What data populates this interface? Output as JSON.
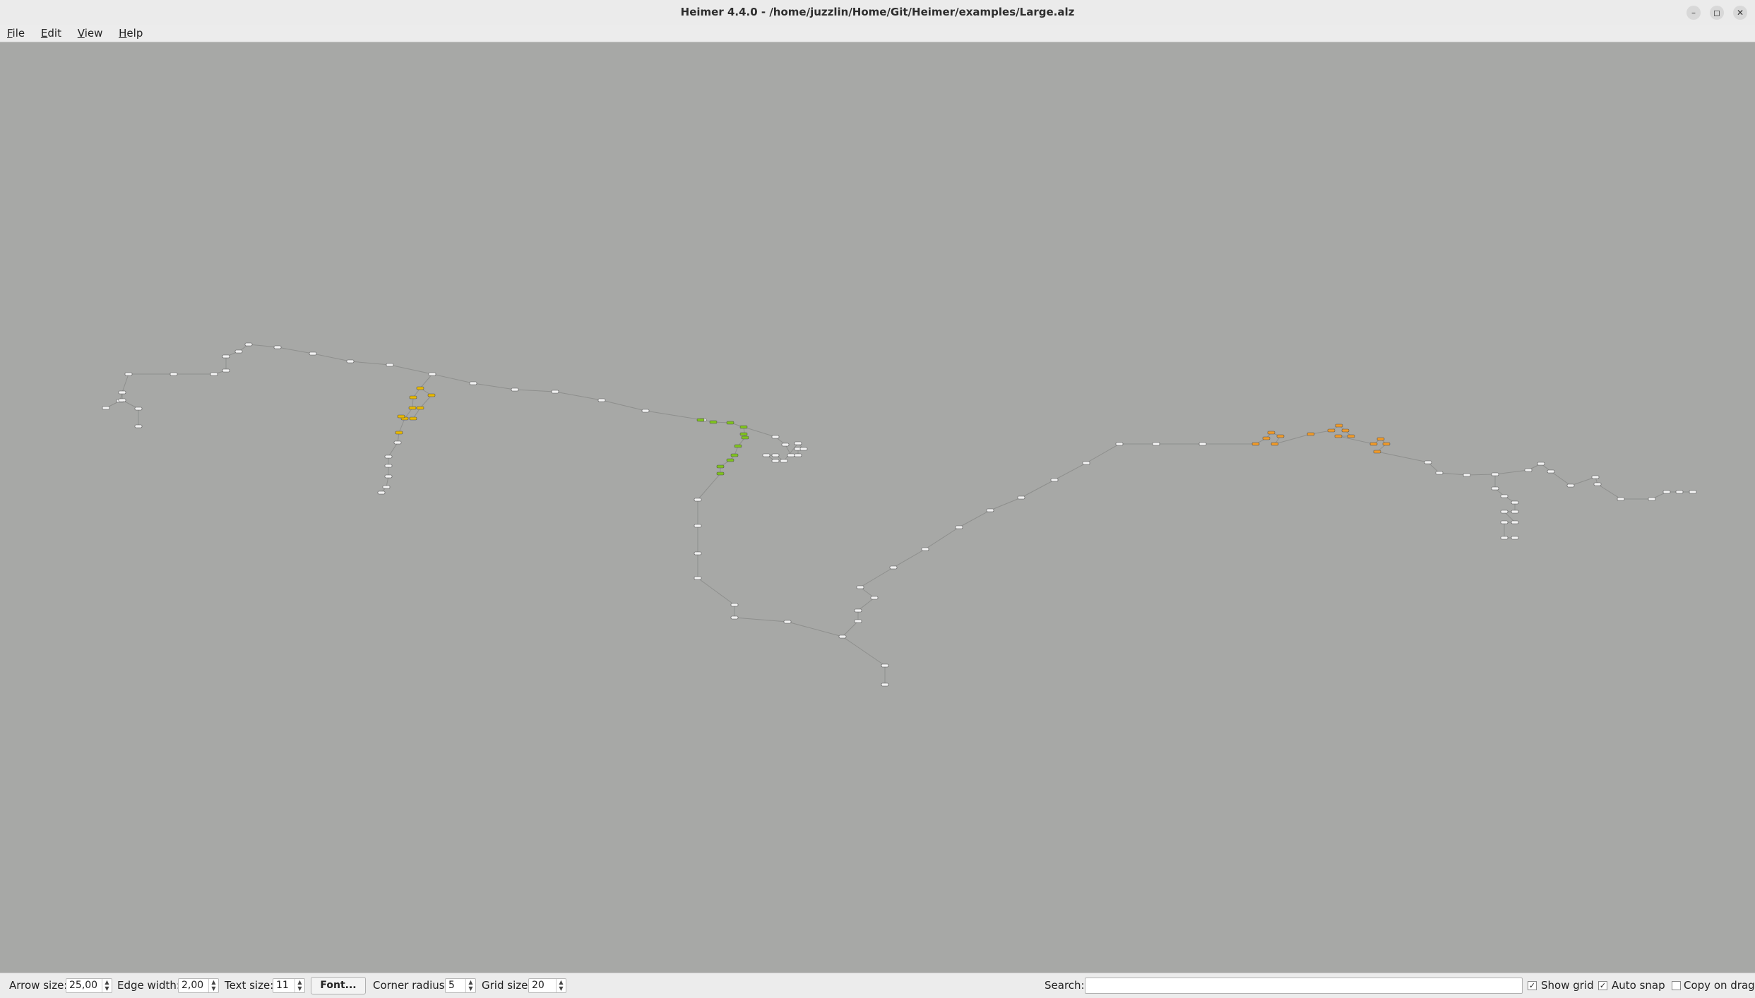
{
  "window": {
    "title": "Heimer 4.4.0 - /home/juzzlin/Home/Git/Heimer/examples/Large.alz",
    "minimize_glyph": "–",
    "maximize_glyph": "◻",
    "close_glyph": "✕"
  },
  "menubar": {
    "items": [
      {
        "mnemonic": "F",
        "rest": "ile"
      },
      {
        "mnemonic": "E",
        "rest": "dit"
      },
      {
        "mnemonic": "V",
        "rest": "iew"
      },
      {
        "mnemonic": "H",
        "rest": "elp"
      }
    ]
  },
  "canvas": {
    "background": "#a7a8a6",
    "edge_color": "#8e8f8d",
    "node_colors": {
      "white": "#f2f2f2",
      "yellow": "#e8b800",
      "green": "#7fc31d",
      "orange": "#f09a28"
    }
  },
  "statusbar": {
    "arrow_size_label": "Arrow size:",
    "arrow_size_value": "25,00",
    "edge_width_label": "Edge width:",
    "edge_width_value": "2,00",
    "text_size_label": "Text size:",
    "text_size_value": "11",
    "font_button": "Font...",
    "corner_radius_label": "Corner radius:",
    "corner_radius_value": "5",
    "grid_size_label": "Grid size:",
    "grid_size_value": "20",
    "search_label": "Search:",
    "search_value": "",
    "show_grid_label": "Show grid",
    "show_grid_checked": true,
    "auto_snap_label": "Auto snap",
    "auto_snap_checked": true,
    "copy_on_drag_label": "Copy on drag",
    "copy_on_drag_checked": false
  }
}
